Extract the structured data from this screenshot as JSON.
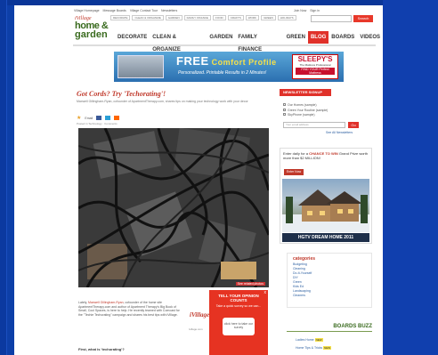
{
  "topnav": {
    "items": [
      "Village Homepage",
      "Message Boards",
      "Village Contact Tour",
      "Newsletters"
    ],
    "signin": "Sign in",
    "register": "Join Now"
  },
  "subnav": [
    "DECORATE",
    "CLEAN & ORGANIZE",
    "GARDEN",
    "FAMILY FINANCE",
    "FOOD",
    "CRAFTS",
    "WORK",
    "GREEN",
    "HOLIDAYS"
  ],
  "search": {
    "button": "Search"
  },
  "logo": {
    "brand": "iVillage",
    "line1": "home &",
    "line2": "garden"
  },
  "mainnav": [
    "DECORATE",
    "CLEAN & ORGANIZE",
    "GARDEN",
    "FAMILY FINANCE",
    "GREEN",
    "BLOG",
    "BOARDS",
    "VIDEOS"
  ],
  "banner": {
    "free": "FREE",
    "comfort": "Comfort Profile",
    "sub": "Personalized. Printable Results in 2 Minutes!",
    "sleepys": "SLEEPY'S",
    "sleepys_tag": "The Mattress Professional",
    "sleepys_box": "FIND YOUR Perfect Mattress"
  },
  "article": {
    "title": "Got Cords? Try 'Techorating'!",
    "byline": "Maxwell Gillingham-Ryan, cofounder of ApartmentTherapy.com, shares tips on making your technology work with your decor",
    "share": "Email",
    "meta": "Posted in Technology · Comments",
    "photo_caption": "See related photos",
    "body_intro": "Lately,",
    "body_name": "Maxwell Gillingham-Ryan",
    "body_text": ", cofounder of the home site ApartmentTherapy.com and author of Apartment Therapy's Big Book of Small, Cool Spaces, is here to help. He recently teamed with Comcast for the \"Techie Techorating\" campaign and shares his best tips with iVillage.",
    "subhead": "First, what is 'techorating'?"
  },
  "popup": {
    "title": "TELL YOUR OPINION COUNTS",
    "subtitle": "Take a quick survey so we can...",
    "button": "click here to take our survey",
    "close": "x"
  },
  "logo2": {
    "brand": "iVillage",
    "small": "ivillage.com"
  },
  "newsletter": {
    "header": "NEWSLETTER SIGNUP",
    "options": [
      "Our Homes (sample)",
      "Green Your Routine (sample)",
      "SkyPhone (sample)"
    ],
    "email_placeholder": "Your email address",
    "go": "Go",
    "more": "See All Newsletters"
  },
  "ad2": {
    "text_a": "Enter daily for a",
    "text_b": "CHANCE TO WIN",
    "text_c": "Grand Prize worth more than $2 MILLION!",
    "enter": "Enter Now",
    "footer": "HGTV DREAM HOME 2011"
  },
  "categories": {
    "title": "categories",
    "items": [
      "Budgeting",
      "Cleaning",
      "Do-It-Yourself",
      "DIY",
      "Green",
      "Kids Ed",
      "Landscaping",
      "Cleaners"
    ]
  },
  "buzz": {
    "title": "BOARDS BUZZ",
    "items": [
      "Ladies Home",
      "Home Tips & Tricks"
    ],
    "new": "NEW"
  }
}
